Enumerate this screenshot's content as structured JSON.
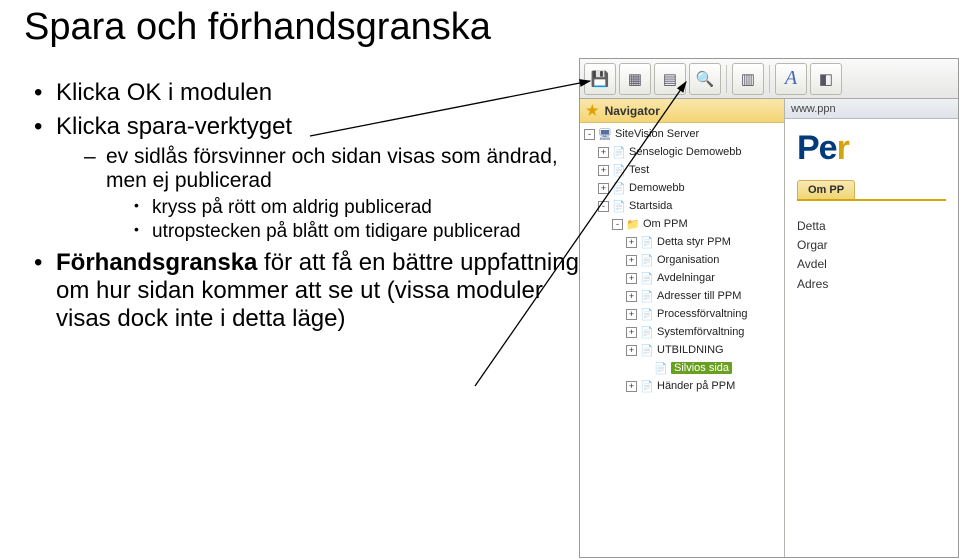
{
  "title": "Spara och förhandsgranska",
  "bullets": {
    "b1": "Klicka OK i modulen",
    "b2": "Klicka spara-verktyget",
    "b2_1": "ev sidlås försvinner och sidan visas som ändrad, men ej publicerad",
    "b2_1_1": "kryss på rött om aldrig publicerad",
    "b2_1_2": "utropstecken på blått om tidigare publicerad",
    "b3_pre": "Förhandsgranska",
    "b3_rest": " för att få en bättre uppfattning om hur sidan kommer att se ut (vissa moduler visas dock inte i detta läge)"
  },
  "nav": {
    "header": "Navigator",
    "items": [
      {
        "depth": 0,
        "exp": "-",
        "icon": "server",
        "label": "SiteVision Server"
      },
      {
        "depth": 1,
        "exp": "+",
        "icon": "page",
        "label": "Senselogic Demowebb"
      },
      {
        "depth": 1,
        "exp": "+",
        "icon": "page",
        "label": "Test"
      },
      {
        "depth": 1,
        "exp": "+",
        "icon": "page",
        "label": "Demowebb"
      },
      {
        "depth": 1,
        "exp": "-",
        "icon": "page",
        "label": "Startsida"
      },
      {
        "depth": 2,
        "exp": "-",
        "icon": "folder",
        "label": "Om PPM"
      },
      {
        "depth": 3,
        "exp": "+",
        "icon": "page",
        "label": "Detta styr PPM"
      },
      {
        "depth": 3,
        "exp": "+",
        "icon": "page",
        "label": "Organisation"
      },
      {
        "depth": 3,
        "exp": "+",
        "icon": "page",
        "label": "Avdelningar"
      },
      {
        "depth": 3,
        "exp": "+",
        "icon": "page",
        "label": "Adresser till PPM"
      },
      {
        "depth": 3,
        "exp": "+",
        "icon": "page",
        "label": "Processförvaltning"
      },
      {
        "depth": 3,
        "exp": "+",
        "icon": "page",
        "label": "Systemförvaltning"
      },
      {
        "depth": 3,
        "exp": "+",
        "icon": "page",
        "label": "UTBILDNING"
      },
      {
        "depth": 4,
        "exp": " ",
        "icon": "page",
        "label": "Silvios sida",
        "selected": true
      },
      {
        "depth": 3,
        "exp": "+",
        "icon": "page",
        "label": "Händer på PPM"
      }
    ]
  },
  "browser": {
    "url": "www.ppn"
  },
  "logo": {
    "part1": "Pe",
    "part2": "r"
  },
  "tab": {
    "label": "Om PP"
  },
  "preview_lines": [
    "Detta",
    "Orgar",
    "Avdel",
    "Adres"
  ]
}
